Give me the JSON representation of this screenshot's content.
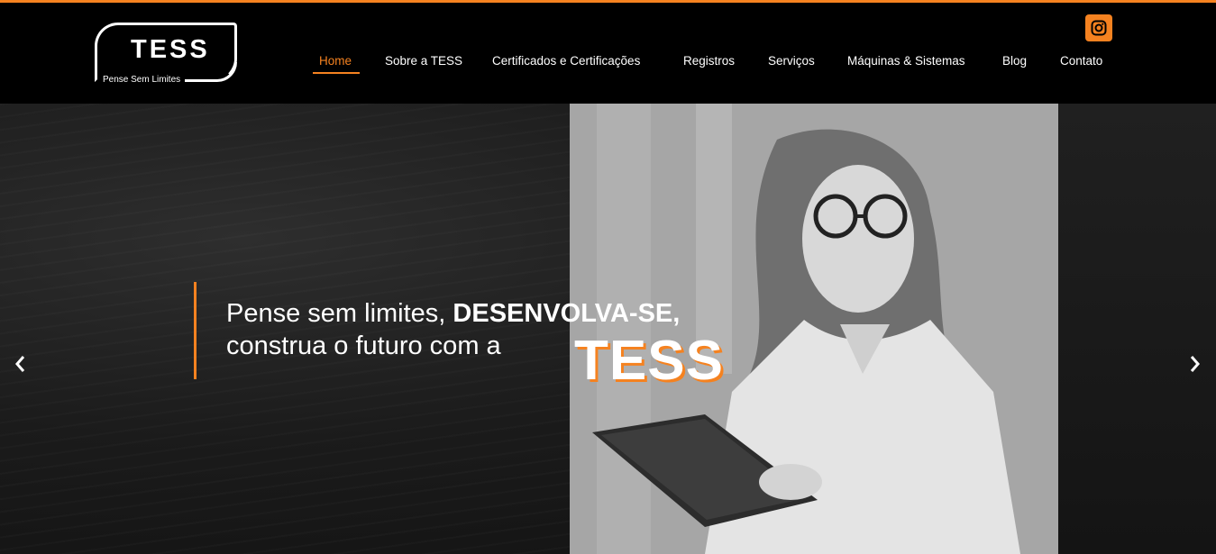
{
  "brand": {
    "name": "TESS",
    "tagline": "Pense Sem Limites"
  },
  "nav": {
    "items": [
      {
        "label": "Home",
        "active": true
      },
      {
        "label": "Sobre a TESS",
        "active": false
      },
      {
        "label": "Certificados e Certificações",
        "active": false
      },
      {
        "label": "Registros",
        "active": false
      },
      {
        "label": "Serviços",
        "active": false
      },
      {
        "label": "Máquinas & Sistemas",
        "active": false
      },
      {
        "label": "Blog",
        "active": false
      },
      {
        "label": "Contato",
        "active": false
      }
    ]
  },
  "social": {
    "instagram_icon": "instagram-icon"
  },
  "hero": {
    "line1_prefix": "Pense sem limites, ",
    "line1_strong": "DESENVOLVA-SE,",
    "line2": "construa o futuro com a",
    "brand_word": "TESS",
    "prev_icon": "chevron-left-icon",
    "next_icon": "chevron-right-icon"
  },
  "colors": {
    "accent": "#f58220",
    "background": "#000000",
    "text": "#ffffff"
  }
}
